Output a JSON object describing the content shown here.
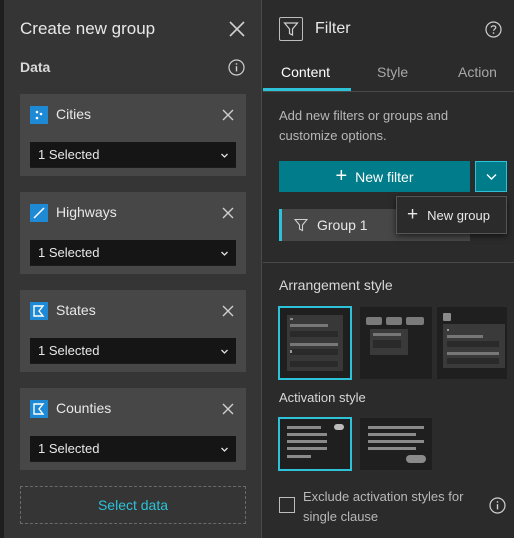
{
  "left_panel": {
    "title": "Create new group",
    "section_label": "Data",
    "datasources": [
      {
        "name": "Cities",
        "icon": "point-layer-icon",
        "selection": "1 Selected"
      },
      {
        "name": "Highways",
        "icon": "line-layer-icon",
        "selection": "1 Selected"
      },
      {
        "name": "States",
        "icon": "polygon-layer-icon",
        "selection": "1 Selected"
      },
      {
        "name": "Counties",
        "icon": "polygon-layer-icon",
        "selection": "1 Selected"
      }
    ],
    "select_data_label": "Select data"
  },
  "right_panel": {
    "title": "Filter",
    "tabs": [
      {
        "label": "Content",
        "active": true
      },
      {
        "label": "Style",
        "active": false
      },
      {
        "label": "Action",
        "active": false
      }
    ],
    "description": "Add new filters or groups and customize options.",
    "new_filter_label": "New filter",
    "group_label": "Group 1",
    "menu_item_label": "New group",
    "arrangement_title": "Arrangement style",
    "activation_title": "Activation style",
    "checkbox_label": "Exclude activation styles for single clause"
  },
  "colors": {
    "accent": "#2dc2d8",
    "primary_button": "#007c8a",
    "layer_icon_bg": "#1e8ad6",
    "panel_bg": "#353535",
    "card_bg": "#474747"
  }
}
